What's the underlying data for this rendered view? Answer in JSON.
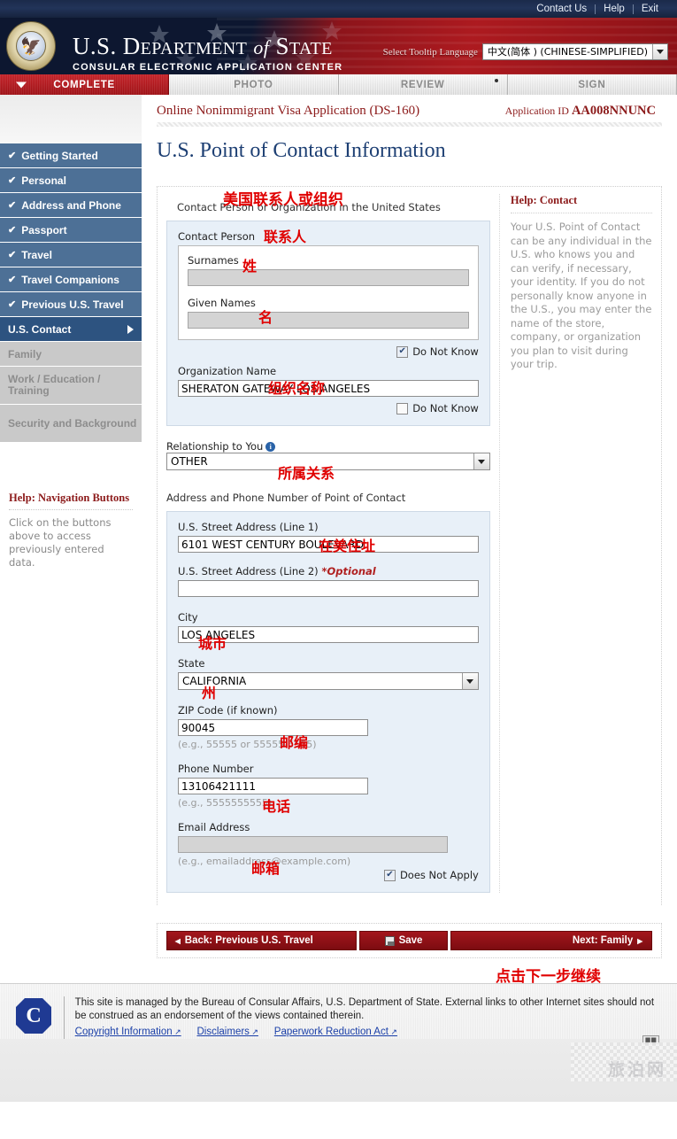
{
  "utility": {
    "links": [
      "Contact Us",
      "Help",
      "Exit"
    ]
  },
  "banner": {
    "title_html": "U.S. DEPARTMENT of STATE",
    "title_part1": "U.S. D",
    "title_part2": "EPARTMENT",
    "title_part3": "of",
    "title_part4": "S",
    "title_part5": "TATE",
    "subtitle": "CONSULAR ELECTRONIC APPLICATION CENTER",
    "language_label": "Select Tooltip Language",
    "language_value": "中文(简体 ) (CHINESE-SIMPLIFIED)"
  },
  "tabs": [
    {
      "label": "COMPLETE",
      "active": true
    },
    {
      "label": "PHOTO",
      "active": false
    },
    {
      "label": "REVIEW",
      "active": false
    },
    {
      "label": "SIGN",
      "active": false
    }
  ],
  "sidebar": {
    "items": [
      {
        "label": "Getting Started",
        "state": "done"
      },
      {
        "label": "Personal",
        "state": "done"
      },
      {
        "label": "Address and Phone",
        "state": "done"
      },
      {
        "label": "Passport",
        "state": "done"
      },
      {
        "label": "Travel",
        "state": "done"
      },
      {
        "label": "Travel Companions",
        "state": "done"
      },
      {
        "label": "Previous U.S. Travel",
        "state": "done"
      },
      {
        "label": "U.S. Contact",
        "state": "current"
      },
      {
        "label": "Family",
        "state": "disabled"
      },
      {
        "label": "Work / Education / Training",
        "state": "disabled"
      },
      {
        "label": "Security and Background",
        "state": "disabled"
      }
    ],
    "help_title": "Help: Navigation Buttons",
    "help_body": "Click on the buttons above to access previously entered data."
  },
  "header": {
    "app_title": "Online Nonimmigrant Visa Application (DS-160)",
    "app_id_label": "Application ID",
    "app_id_value": "AA008NNUNC",
    "page_title": "U.S. Point of Contact Information"
  },
  "form": {
    "section_label": "Contact Person or Organization in the United States",
    "contact_person_label": "Contact Person",
    "surnames_label": "Surnames",
    "surnames_value": "",
    "given_names_label": "Given Names",
    "given_names_value": "",
    "do_not_know_label": "Do Not Know",
    "person_do_not_know_checked": true,
    "organization_label": "Organization Name",
    "organization_value": "SHERATON GATEWAY LOS ANGELES",
    "org_do_not_know_checked": false,
    "relationship_label": "Relationship to You",
    "relationship_value": "OTHER",
    "address_section_label": "Address and Phone Number of Point of Contact",
    "street1_label": "U.S. Street Address (Line 1)",
    "street1_value": "6101 WEST CENTURY BOULEVARD",
    "street2_label": "U.S. Street Address (Line 2)",
    "street2_optional": "*Optional",
    "street2_value": "",
    "city_label": "City",
    "city_value": "LOS ANGELES",
    "state_label": "State",
    "state_value": "CALIFORNIA",
    "zip_label": "ZIP Code (if known)",
    "zip_value": "90045",
    "zip_hint": "(e.g., 55555 or 55555-5555)",
    "phone_label": "Phone Number",
    "phone_value": "13106421111",
    "phone_hint": "(e.g., 5555555555)",
    "email_label": "Email Address",
    "email_value": "",
    "email_hint": "(e.g., emailaddress@example.com)",
    "does_not_apply_label": "Does Not Apply",
    "email_does_not_apply_checked": true
  },
  "help_panel": {
    "title": "Help: Contact",
    "body": "Your U.S. Point of Contact can be any individual in the U.S. who knows you and can verify, if necessary, your identity. If you do not personally know anyone in the U.S., you may enter the name of the store, company, or organization you plan to visit during your trip."
  },
  "annotations": {
    "contact_org": "美国联系人或组织",
    "contact_person": "联系人",
    "surnames": "姓",
    "given_names": "名",
    "organization": "组织名称",
    "relationship": "所属关系",
    "street_address": "在美住址",
    "city": "城市",
    "state": "州",
    "zip": "邮编",
    "phone": "电话",
    "email": "邮箱",
    "next_step": "点击下一步继续"
  },
  "buttons": {
    "back": "Back: Previous U.S. Travel",
    "save": "Save",
    "next": "Next: Family"
  },
  "footer": {
    "text": "This site is managed by the Bureau of Consular Affairs, U.S. Department of State. External links to other Internet sites should not be construed as an endorsement of the views contained therein.",
    "links": [
      "Copyright Information",
      "Disclaimers",
      "Paperwork Reduction Act"
    ],
    "watermark": "旅泊网"
  },
  "colors": {
    "brand_red": "#9d0f14",
    "nav_blue": "#4d7096",
    "nav_current": "#2d5380",
    "panel_blue": "#e8f0f8",
    "annotation_red": "#e00000",
    "title_blue": "#1d3f73"
  }
}
